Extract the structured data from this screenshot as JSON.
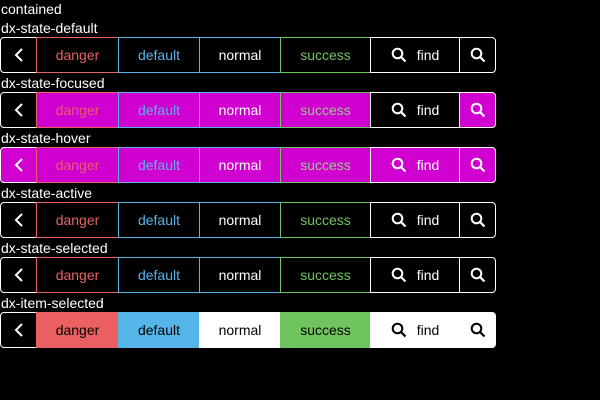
{
  "heading": "contained",
  "buttons": {
    "danger": "danger",
    "default": "default",
    "normal": "normal",
    "success": "success",
    "find": "find"
  },
  "icons": {
    "back": "chevron-left-icon",
    "search": "search-icon"
  },
  "colors": {
    "background": "#000000",
    "danger": "#e86262",
    "default": "#57b3e8",
    "success": "#71c45f",
    "focused_fill": "#d000d0",
    "normal": "#ffffff"
  },
  "groups": [
    {
      "label": "dx-state-default"
    },
    {
      "label": "dx-state-focused"
    },
    {
      "label": "dx-state-hover"
    },
    {
      "label": "dx-state-active"
    },
    {
      "label": "dx-state-selected"
    },
    {
      "label": "dx-item-selected"
    }
  ]
}
